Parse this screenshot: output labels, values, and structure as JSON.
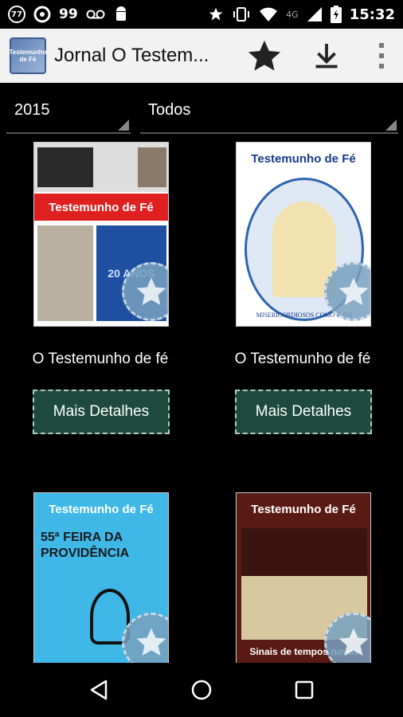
{
  "status_bar": {
    "badge": "77",
    "count": "99",
    "network": "4G",
    "time": "15:32"
  },
  "action_bar": {
    "app_logo_text": "Testemunho de Fé",
    "title": "Jornal O Testemunho de Fé",
    "title_display": "Jornal O Testem..."
  },
  "filters": {
    "year": "2015",
    "category": "Todos"
  },
  "items": [
    {
      "title": "O Testemunho de fé",
      "button": "Mais Detalhes",
      "cover_header": "Testemunho de Fé",
      "cover_sub": "20 ANOS"
    },
    {
      "title": "O Testemunho de fé",
      "button": "Mais Detalhes",
      "cover_header": "Testemunho de Fé",
      "cover_sub": "MISERICORDIOSOS COMO O PAI"
    },
    {
      "title": "",
      "button": "",
      "cover_header": "Testemunho de Fé",
      "cover_sub": "55ª FEIRA DA PROVIDÊNCIA"
    },
    {
      "title": "",
      "button": "",
      "cover_header": "Testemunho de Fé",
      "cover_sub": "Sinais de tempos novos"
    }
  ],
  "colors": {
    "background": "#000000",
    "action_bar": "#f2f2f2",
    "button_bg": "#1d4a3c",
    "badge": "#78a0be"
  }
}
